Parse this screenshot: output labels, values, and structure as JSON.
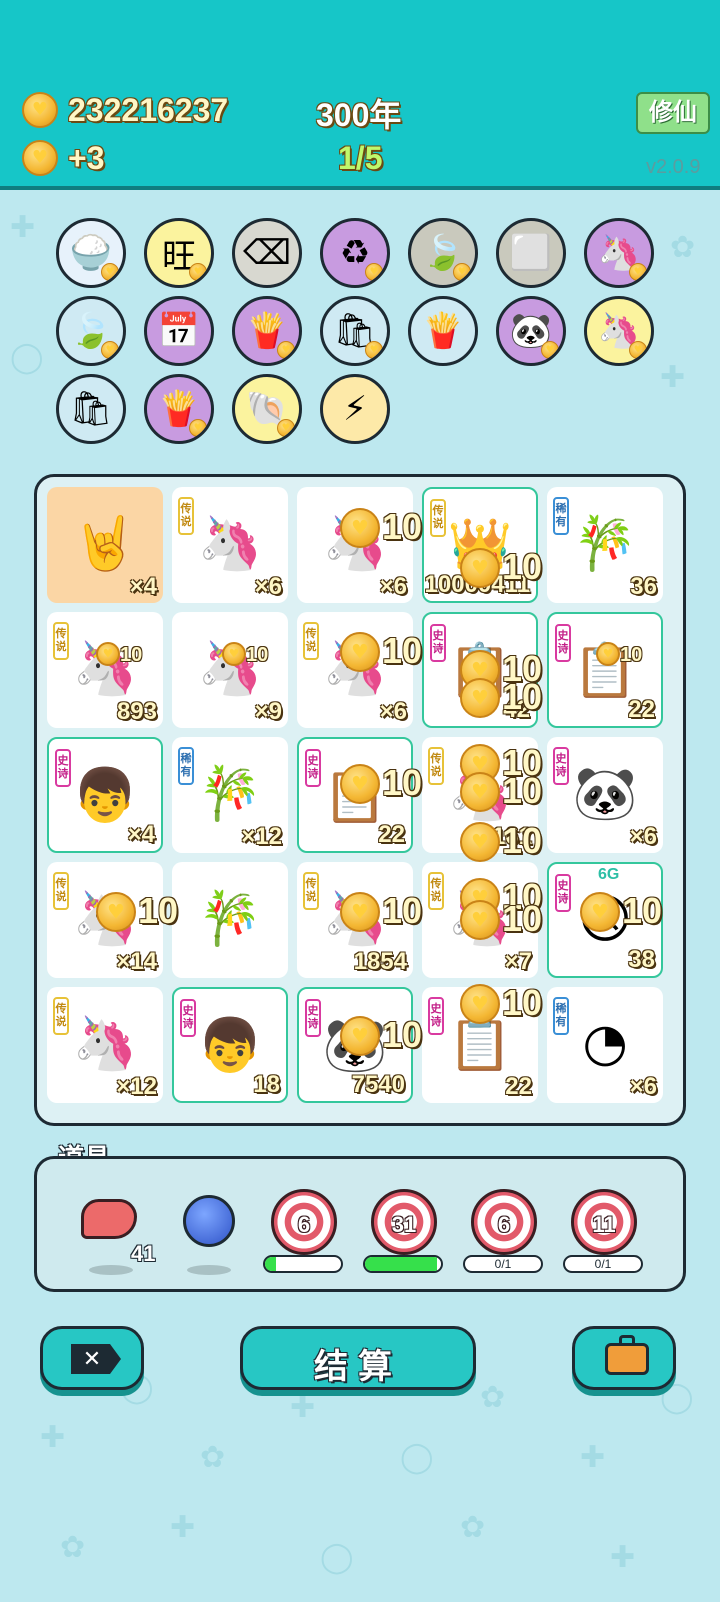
{
  "header": {
    "coins": "232216237",
    "income": "+3",
    "year": "300年",
    "progress": "1/5",
    "mode_button": "修仙",
    "version": "v2.0.9"
  },
  "items": [
    {
      "icon": "rice-bowl",
      "glyph": "🍚",
      "bg": "#e7f2fb"
    },
    {
      "icon": "wang-tiles",
      "glyph": "旺",
      "bg": "#fbf39e"
    },
    {
      "icon": "delete-key",
      "glyph": "⌫",
      "bg": "#d8d8d0"
    },
    {
      "icon": "recycle",
      "glyph": "♻",
      "bg": "#c89be0"
    },
    {
      "icon": "leaf",
      "glyph": "🍃",
      "bg": "#c9c9bd"
    },
    {
      "icon": "sugar-cubes",
      "glyph": "⬜",
      "bg": "#c9c9bd"
    },
    {
      "icon": "unicorn-pair",
      "glyph": "🦄",
      "bg": "#c89be0"
    },
    {
      "icon": "leaf",
      "glyph": "🍃",
      "bg": "#cfeaf3"
    },
    {
      "icon": "calendar",
      "glyph": "📅",
      "bg": "#c89be0"
    },
    {
      "icon": "fries",
      "glyph": "🍟",
      "bg": "#c89be0"
    },
    {
      "icon": "trash-bag",
      "glyph": "🛍",
      "bg": "#cfeaf3"
    },
    {
      "icon": "fries",
      "glyph": "🍟",
      "bg": "#cfeaf3"
    },
    {
      "icon": "panda",
      "glyph": "🐼",
      "bg": "#c89be0"
    },
    {
      "icon": "unicorn",
      "glyph": "🦄",
      "bg": "#fbf39e"
    },
    {
      "icon": "trash-bag",
      "glyph": "🛍",
      "bg": "#cfeaf3"
    },
    {
      "icon": "fries",
      "glyph": "🍟",
      "bg": "#c89be0"
    },
    {
      "icon": "shell",
      "glyph": "🐚",
      "bg": "#fbf39e"
    },
    {
      "icon": "lightning",
      "glyph": "⚡",
      "bg": "#fde9a8"
    }
  ],
  "board": [
    {
      "tag": "",
      "tone": "",
      "glyph": "🤘",
      "icon": "rock-hand",
      "count": "×4",
      "style": "orange"
    },
    {
      "tag": "传说",
      "tone": "y",
      "glyph": "🦄",
      "icon": "unicorn",
      "count": "×6",
      "style": ""
    },
    {
      "tag": "",
      "tone": "",
      "glyph": "🦄",
      "icon": "unicorn",
      "count": "×6",
      "style": ""
    },
    {
      "tag": "传说",
      "tone": "y",
      "glyph": "👑",
      "icon": "king",
      "count": "10000411",
      "style": "hl"
    },
    {
      "tag": "稀有",
      "tone": "b",
      "glyph": "🎋",
      "icon": "bamboo",
      "count": "36",
      "style": ""
    },
    {
      "tag": "传说",
      "tone": "y",
      "glyph": "🦄",
      "icon": "unicorn",
      "count": "893",
      "style": ""
    },
    {
      "tag": "",
      "tone": "",
      "glyph": "🦄",
      "icon": "unicorn-ripple",
      "count": "×9",
      "style": ""
    },
    {
      "tag": "传说",
      "tone": "y",
      "glyph": "🦄",
      "icon": "unicorn",
      "count": "×6",
      "style": ""
    },
    {
      "tag": "史诗",
      "tone": "m",
      "glyph": "📋",
      "icon": "copy-paste",
      "count": "42",
      "style": "hl"
    },
    {
      "tag": "史诗",
      "tone": "m",
      "glyph": "📋",
      "icon": "copy-paste",
      "count": "22",
      "style": "hl"
    },
    {
      "tag": "史诗",
      "tone": "m",
      "glyph": "👦",
      "icon": "boy-red-hat",
      "count": "×4",
      "style": "hl"
    },
    {
      "tag": "稀有",
      "tone": "b",
      "glyph": "🎋",
      "icon": "bamboo",
      "count": "×12",
      "style": ""
    },
    {
      "tag": "史诗",
      "tone": "m",
      "glyph": "📋",
      "icon": "copy-paste",
      "count": "22",
      "style": "hl"
    },
    {
      "tag": "传说",
      "tone": "y",
      "glyph": "🦄",
      "icon": "unicorn",
      "count": "161",
      "style": ""
    },
    {
      "tag": "史诗",
      "tone": "m",
      "glyph": "🐼",
      "icon": "panda",
      "count": "×6",
      "style": ""
    },
    {
      "tag": "传说",
      "tone": "y",
      "glyph": "🦄",
      "icon": "unicorn",
      "count": "×14",
      "style": ""
    },
    {
      "tag": "",
      "tone": "",
      "glyph": "🎋",
      "icon": "bamboo",
      "count": "",
      "style": ""
    },
    {
      "tag": "传说",
      "tone": "y",
      "glyph": "🦄",
      "icon": "unicorn",
      "count": "1854",
      "style": ""
    },
    {
      "tag": "传说",
      "tone": "y",
      "glyph": "🦄",
      "icon": "unicorn",
      "count": "×7",
      "style": ""
    },
    {
      "tag": "史诗",
      "tone": "m",
      "glyph": "😠",
      "icon": "angry-boy",
      "count": "38",
      "style": "hl"
    },
    {
      "tag": "传说",
      "tone": "y",
      "glyph": "🦄",
      "icon": "unicorn",
      "count": "×12",
      "style": ""
    },
    {
      "tag": "史诗",
      "tone": "m",
      "glyph": "👦",
      "icon": "boy-red-hat",
      "count": "18",
      "style": "hl"
    },
    {
      "tag": "史诗",
      "tone": "m",
      "glyph": "🐼",
      "icon": "panda",
      "count": "7540",
      "style": "hl"
    },
    {
      "tag": "史诗",
      "tone": "m",
      "glyph": "📋",
      "icon": "copy-paste",
      "count": "22",
      "style": ""
    },
    {
      "tag": "稀有",
      "tone": "b",
      "glyph": "◔",
      "icon": "speed-gauge",
      "count": "×6",
      "style": ""
    }
  ],
  "float_value": "10",
  "small_float": "10",
  "badge_6g": "6G",
  "tools": {
    "title": "道具",
    "liver_count": "41",
    "targets": [
      "6",
      "31",
      "6",
      "11"
    ],
    "bar_labels": [
      "",
      "",
      "0/1",
      "0/1"
    ],
    "bar_fill": [
      0.15,
      0.95,
      0,
      0
    ]
  },
  "buttons": {
    "settle": "结算"
  }
}
